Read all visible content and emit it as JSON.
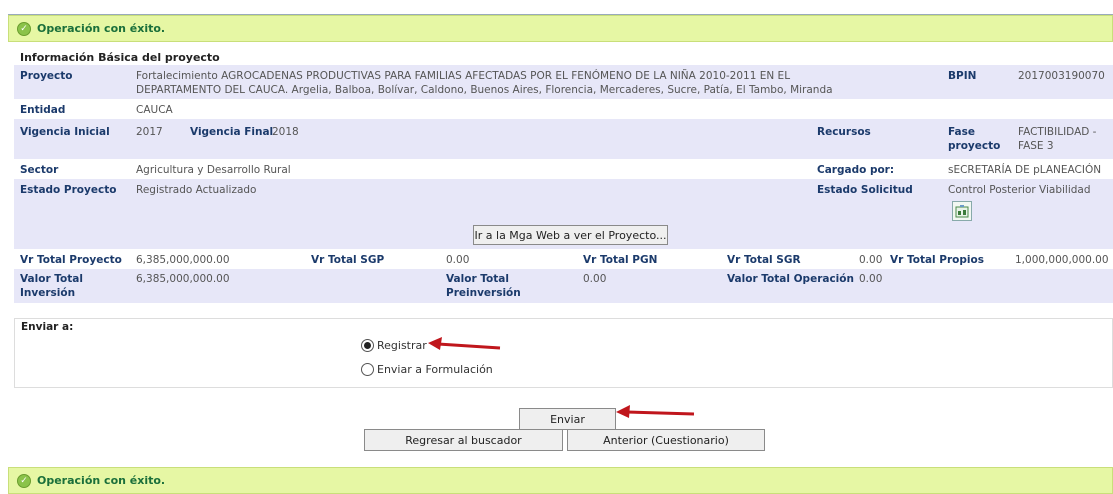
{
  "status": {
    "message": "Operación con éxito."
  },
  "section_title": "Información Básica del proyecto",
  "project": {
    "label": "Proyecto",
    "value_line1": "Fortalecimiento AGROCADENAS PRODUCTIVAS PARA FAMILIAS AFECTADAS POR EL FENÓMENO DE LA NIÑA 2010-2011 EN EL",
    "value_line2": "DEPARTAMENTO DEL CAUCA. Argelia, Balboa, Bolívar, Caldono, Buenos Aires, Florencia, Mercaderes, Sucre, Patía, El Tambo, Miranda",
    "bpin_label": "BPIN",
    "bpin_value": "2017003190070"
  },
  "entidad": {
    "label": "Entidad",
    "value": "CAUCA"
  },
  "vigencia": {
    "inicial_label": "Vigencia Inicial",
    "inicial_value": "2017",
    "final_label": "Vigencia Final",
    "final_value": "2018",
    "recursos_label": "Recursos",
    "fase_label_1": "Fase",
    "fase_label_2": "proyecto",
    "fase_value_1": "FACTIBILIDAD -",
    "fase_value_2": "FASE 3"
  },
  "sector": {
    "label": "Sector",
    "value": "Agricultura y Desarrollo Rural",
    "cargado_label": "Cargado por:",
    "cargado_value": "sECRETARÍA DE pLANEACIÓN"
  },
  "estado": {
    "label": "Estado Proyecto",
    "value": "Registrado Actualizado",
    "solicitud_label": "Estado Solicitud",
    "solicitud_value": "Control Posterior Viabilidad"
  },
  "mga_button": "Ir a la Mga Web a ver el Proyecto...",
  "totals": {
    "vr_total_proyecto_label": "Vr Total Proyecto",
    "vr_total_proyecto": "6,385,000,000.00",
    "vr_total_sgp_label": "Vr Total SGP",
    "vr_total_sgp": "0.00",
    "vr_total_pgn_label": "Vr Total PGN",
    "vr_total_sgr_label": "Vr Total SGR",
    "vr_total_sgr": "0.00",
    "vr_total_propios_label": "Vr Total Propios",
    "vr_total_propios": "1,000,000,000.00",
    "valor_total_inversion_label_1": "Valor Total",
    "valor_total_inversion_label_2": "Inversión",
    "valor_total_inversion": "6,385,000,000.00",
    "valor_total_preinversion_label_1": "Valor Total",
    "valor_total_preinversion_label_2": "Preinversión",
    "valor_total_preinversion": "0.00",
    "valor_total_operacion_label": "Valor Total Operación",
    "valor_total_operacion": "0.00"
  },
  "send": {
    "title": "Enviar a:",
    "option_registrar": "Registrar",
    "option_formulacion": "Enviar a Formulación",
    "selected": "Registrar"
  },
  "buttons": {
    "enviar": "Enviar",
    "regresar": "Regresar al buscador",
    "anterior": "Anterior (Cuestionario)"
  },
  "colors": {
    "success_bg": "#e6f7a4",
    "label_blue": "#1b3a6b",
    "row_alt": "#e7e7f8",
    "arrow_red": "#c0161c"
  }
}
